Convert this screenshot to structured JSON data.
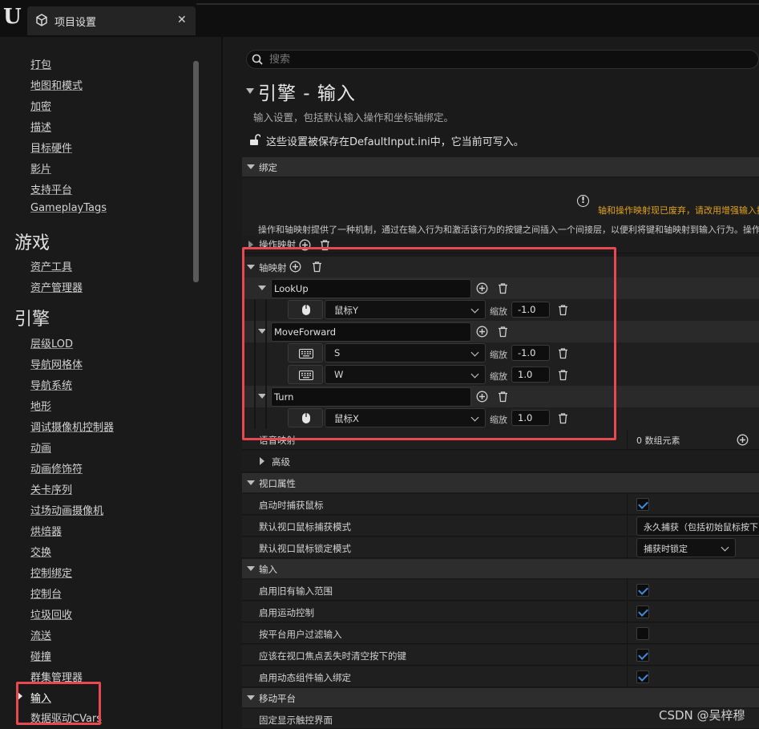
{
  "window": {
    "tab_title": "项目设置"
  },
  "sidebar": {
    "items_top": [
      "打包",
      "地图和模式",
      "加密",
      "描述",
      "目标硬件",
      "影片",
      "支持平台",
      "GameplayTags"
    ],
    "section_game": "游戏",
    "items_game": [
      "资产工具",
      "资产管理器"
    ],
    "section_engine": "引擎",
    "items_engine": [
      "层级LOD",
      "导航网格体",
      "导航系统",
      "地形",
      "调试摄像机控制器",
      "动画",
      "动画修饰符",
      "关卡序列",
      "过场动画摄像机",
      "烘焙器",
      "交换",
      "控制绑定",
      "控制台",
      "垃圾回收",
      "流送",
      "碰撞",
      "群集管理器",
      "输入",
      "数据驱动CVars"
    ]
  },
  "search": {
    "placeholder": "搜索"
  },
  "header": {
    "title": "引擎 - 输入",
    "subtitle": "输入设置，包括默认输入操作和坐标轴绑定。",
    "save_note": "这些设置被保存在DefaultInput.ini中，它当前可写入。"
  },
  "bindings": {
    "category": "绑定",
    "warning": "轴和操作映射现已废弃，请改用增强输入插",
    "description": "操作和轴映射提供了一种机制，通过在输入行为和激活该行为的按键之间插入一个间接层，以便利将键和轴映射到输入行为。操作",
    "action_mappings_label": "操作映射",
    "axis_mappings_label": "轴映射",
    "scale_label": "缩放",
    "axis_mappings": [
      {
        "name": "LookUp",
        "keys": [
          {
            "icon": "mouse-icon",
            "key": "鼠标Y",
            "scale": "-1.0"
          }
        ]
      },
      {
        "name": "MoveForward",
        "keys": [
          {
            "icon": "keyboard-icon",
            "key": "S",
            "scale": "-1.0"
          },
          {
            "icon": "keyboard-icon",
            "key": "W",
            "scale": "1.0"
          }
        ]
      },
      {
        "name": "Turn",
        "keys": [
          {
            "icon": "mouse-icon",
            "key": "鼠标X",
            "scale": "1.0"
          }
        ]
      }
    ],
    "speech_mappings_label": "语音映射",
    "speech_mappings_value": "0 数组元素",
    "advanced_label": "高级"
  },
  "viewport": {
    "category": "视口属性",
    "capture_mouse_label": "启动时捕获鼠标",
    "capture_mouse": true,
    "capture_mode_label": "默认视口鼠标捕获模式",
    "capture_mode_value": "永久捕获（包括初始鼠标按下",
    "lock_mode_label": "默认视口鼠标锁定模式",
    "lock_mode_value": "捕获时锁定"
  },
  "input": {
    "category": "输入",
    "rows": [
      {
        "label": "启用旧有输入范围",
        "checked": true
      },
      {
        "label": "启用运动控制",
        "checked": true
      },
      {
        "label": "按平台用户过滤输入",
        "checked": false
      },
      {
        "label": "应该在视口焦点丢失时清空按下的键",
        "checked": true
      },
      {
        "label": "启用动态组件输入绑定",
        "checked": true
      }
    ]
  },
  "mobile": {
    "category": "移动平台",
    "first_row": "固定显示触控界面"
  },
  "watermark": "CSDN @吴梓穆",
  "colors": {
    "accent_red": "#e8484f",
    "check_blue": "#3d8bdc",
    "warning_orange": "#e2a21b"
  }
}
